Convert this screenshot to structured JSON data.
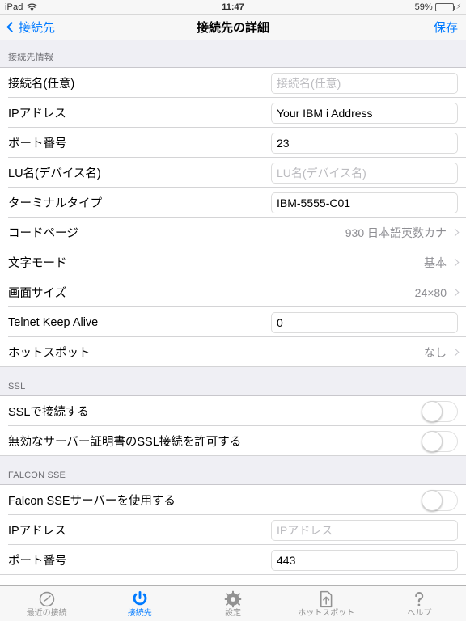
{
  "statusbar": {
    "device": "iPad",
    "wifi_icon": "wifi-icon",
    "time": "11:47",
    "battery_percent": "59%",
    "battery_level": 59,
    "charging_icon": "lightning-bolt-icon"
  },
  "navbar": {
    "back_label": "接続先",
    "back_icon": "chevron-left-icon",
    "title": "接続先の詳細",
    "save_label": "保存"
  },
  "colors": {
    "accent": "#007aff",
    "toggle_on": "#4cd964",
    "section_bg": "#efeff4",
    "detail_text": "#8e8e93"
  },
  "sections": [
    {
      "header": "接続先情報",
      "rows": [
        {
          "label": "接続名(任意)",
          "type": "textfield",
          "value": "",
          "placeholder": "接続名(任意)"
        },
        {
          "label": "IPアドレス",
          "type": "textfield",
          "value": "Your IBM i Address",
          "placeholder": ""
        },
        {
          "label": "ポート番号",
          "type": "textfield",
          "value": "23",
          "placeholder": ""
        },
        {
          "label": "LU名(デバイス名)",
          "type": "textfield",
          "value": "",
          "placeholder": "LU名(デバイス名)"
        },
        {
          "label": "ターミナルタイプ",
          "type": "textfield",
          "value": "IBM-5555-C01",
          "placeholder": ""
        },
        {
          "label": "コードページ",
          "type": "disclosure",
          "value": "930 日本語英数カナ"
        },
        {
          "label": "文字モード",
          "type": "disclosure",
          "value": "基本"
        },
        {
          "label": "画面サイズ",
          "type": "disclosure",
          "value": "24×80"
        },
        {
          "label": "Telnet Keep Alive",
          "type": "textfield",
          "value": "0",
          "placeholder": ""
        },
        {
          "label": "ホットスポット",
          "type": "disclosure",
          "value": "なし"
        }
      ]
    },
    {
      "header": "SSL",
      "rows": [
        {
          "label": "SSLで接続する",
          "type": "toggle",
          "on": false
        },
        {
          "label": "無効なサーバー証明書のSSL接続を許可する",
          "type": "toggle",
          "on": false
        }
      ]
    },
    {
      "header": "FALCON SSE",
      "rows": [
        {
          "label": "Falcon SSEサーバーを使用する",
          "type": "toggle",
          "on": false
        },
        {
          "label": "IPアドレス",
          "type": "textfield",
          "value": "",
          "placeholder": "IPアドレス"
        },
        {
          "label": "ポート番号",
          "type": "textfield",
          "value": "443",
          "placeholder": ""
        }
      ]
    }
  ],
  "tabbar": {
    "tabs": [
      {
        "label": "最近の接続",
        "icon": "clock-icon",
        "active": false
      },
      {
        "label": "接続先",
        "icon": "power-icon",
        "active": true
      },
      {
        "label": "設定",
        "icon": "gear-icon",
        "active": false
      },
      {
        "label": "ホットスポット",
        "icon": "document-upload-icon",
        "active": false
      },
      {
        "label": "ヘルプ",
        "icon": "question-mark-icon",
        "active": false
      }
    ]
  }
}
